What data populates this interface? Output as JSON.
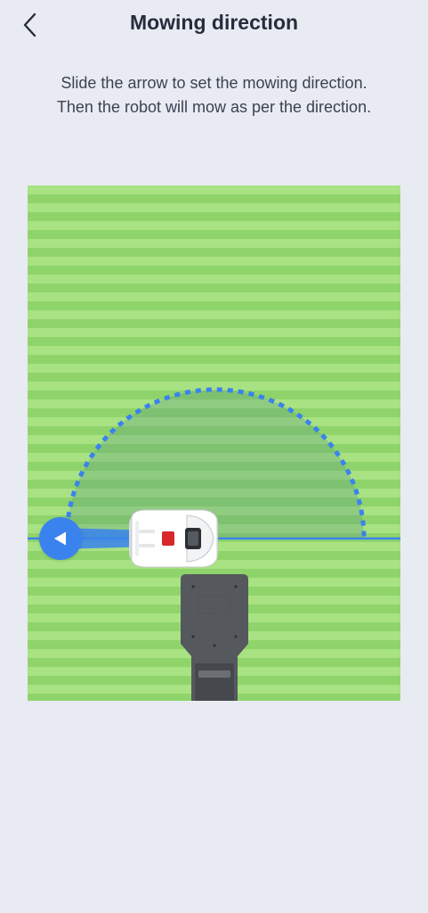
{
  "header": {
    "title": "Mowing direction",
    "back_icon": "chevron-left-icon"
  },
  "instructions": {
    "line1": "Slide the arrow to set the mowing direction.",
    "line2": "Then the robot will mow as per the direction."
  },
  "lawn": {
    "colors": {
      "stripe_light": "#a8e283",
      "stripe_dark": "#8fd46b",
      "direction_line": "#3a82ee",
      "arc": "#3a82ee"
    },
    "direction_handle_icon": "arrow-left-triangle-icon",
    "mower_icon": "robot-mower-icon",
    "dock_icon": "charging-dock-icon"
  }
}
